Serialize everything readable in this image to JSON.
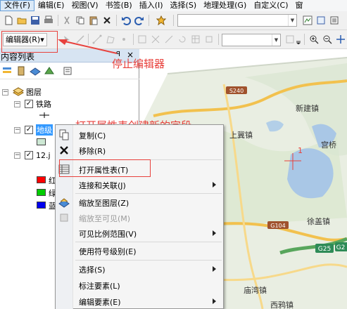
{
  "menubar": {
    "items": [
      "文件(F)",
      "编辑(E)",
      "视图(V)",
      "书签(B)",
      "插入(I)",
      "选择(S)",
      "地理处理(G)",
      "自定义(C)",
      "窗"
    ]
  },
  "toolbar": {
    "editor_label": "编辑器(R)▾"
  },
  "toc": {
    "title": "内容列表",
    "pin": "ꟼ",
    "close": "×",
    "layers_label": "图层",
    "rows": [
      {
        "label": "铁路"
      },
      {
        "label": "地级"
      },
      {
        "label": "12.j"
      }
    ],
    "legend": [
      {
        "label": "红",
        "color": "#ff0000"
      },
      {
        "label": "绿",
        "color": "#00cc00"
      },
      {
        "label": "蓝",
        "color": "#0000ee"
      }
    ]
  },
  "map": {
    "towns": [
      "新建镇",
      "上冀镇",
      "宫桥",
      "徐盖镇",
      "庙湾镇",
      "西鸦镇",
      "S240",
      "G104",
      "G25",
      "G2"
    ],
    "marker_label": "1"
  },
  "annotations": {
    "stop_editor": "停止编辑器",
    "open_attr": "打开属性表创建新的字段"
  },
  "context_menu": {
    "items": [
      {
        "label": "复制(C)",
        "icon": "copy-icon",
        "submenu": false,
        "disabled": false
      },
      {
        "label": "移除(R)",
        "icon": "remove-icon",
        "submenu": false,
        "disabled": false
      },
      {
        "label": "打开属性表(T)",
        "icon": "table-icon",
        "submenu": false,
        "disabled": false
      },
      {
        "label": "连接和关联(J)",
        "icon": "",
        "submenu": true,
        "disabled": false
      },
      {
        "label": "缩放至图层(Z)",
        "icon": "zoom-layer-icon",
        "submenu": false,
        "disabled": false
      },
      {
        "label": "缩放至可见(M)",
        "icon": "zoom-visible-icon",
        "submenu": false,
        "disabled": true
      },
      {
        "label": "可见比例范围(V)",
        "icon": "",
        "submenu": true,
        "disabled": false
      },
      {
        "label": "使用符号级别(E)",
        "icon": "",
        "submenu": false,
        "disabled": false
      },
      {
        "label": "选择(S)",
        "icon": "",
        "submenu": true,
        "disabled": false
      },
      {
        "label": "标注要素(L)",
        "icon": "",
        "submenu": false,
        "disabled": false
      },
      {
        "label": "编辑要素(E)",
        "icon": "",
        "submenu": true,
        "disabled": false
      }
    ]
  },
  "colors": {
    "annotation": "#e8413c",
    "selection": "#3399ff"
  }
}
